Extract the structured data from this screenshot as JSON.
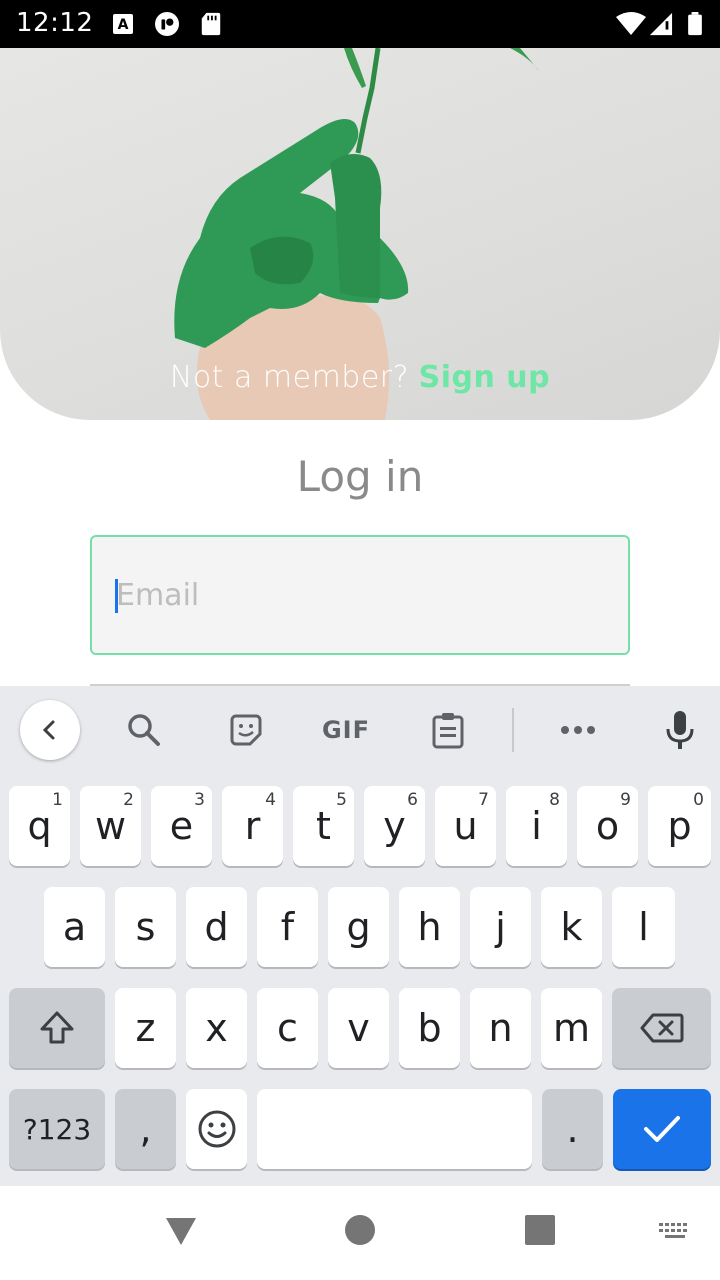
{
  "status_bar": {
    "time": "12:12",
    "icons_left": [
      "a-notification-icon",
      "circle-app-icon",
      "sd-card-icon"
    ],
    "icons_right": [
      "wifi-icon",
      "cell-signal-icon",
      "battery-icon"
    ]
  },
  "hero": {
    "caption_prefix": "Not a member?",
    "caption_link": "Sign up",
    "accent_color": "#6ee7a6"
  },
  "form": {
    "title": "Log in",
    "email": {
      "value": "",
      "placeholder": "Email"
    },
    "field_border_color": "#74e0a8"
  },
  "keyboard": {
    "toolbar": {
      "back_icon": "chevron-left-icon",
      "search_icon": "search-icon",
      "sticker_icon": "sticker-icon",
      "gif_label": "GIF",
      "clipboard_icon": "clipboard-icon",
      "more_icon": "more-icon",
      "mic_icon": "microphone-icon"
    },
    "row1": [
      {
        "key": "q",
        "hint": "1"
      },
      {
        "key": "w",
        "hint": "2"
      },
      {
        "key": "e",
        "hint": "3"
      },
      {
        "key": "r",
        "hint": "4"
      },
      {
        "key": "t",
        "hint": "5"
      },
      {
        "key": "y",
        "hint": "6"
      },
      {
        "key": "u",
        "hint": "7"
      },
      {
        "key": "i",
        "hint": "8"
      },
      {
        "key": "o",
        "hint": "9"
      },
      {
        "key": "p",
        "hint": "0"
      }
    ],
    "row2": [
      "a",
      "s",
      "d",
      "f",
      "g",
      "h",
      "j",
      "k",
      "l"
    ],
    "row3": [
      "z",
      "x",
      "c",
      "v",
      "b",
      "n",
      "m"
    ],
    "bottom": {
      "symbols": "?123",
      "comma": ",",
      "period": ".",
      "space": ""
    },
    "enter_color": "#1a73e8"
  },
  "nav_bar": {
    "back": "back-triangle-icon",
    "home": "home-circle-icon",
    "recents": "recents-square-icon",
    "keyboard": "keyboard-switch-icon"
  }
}
